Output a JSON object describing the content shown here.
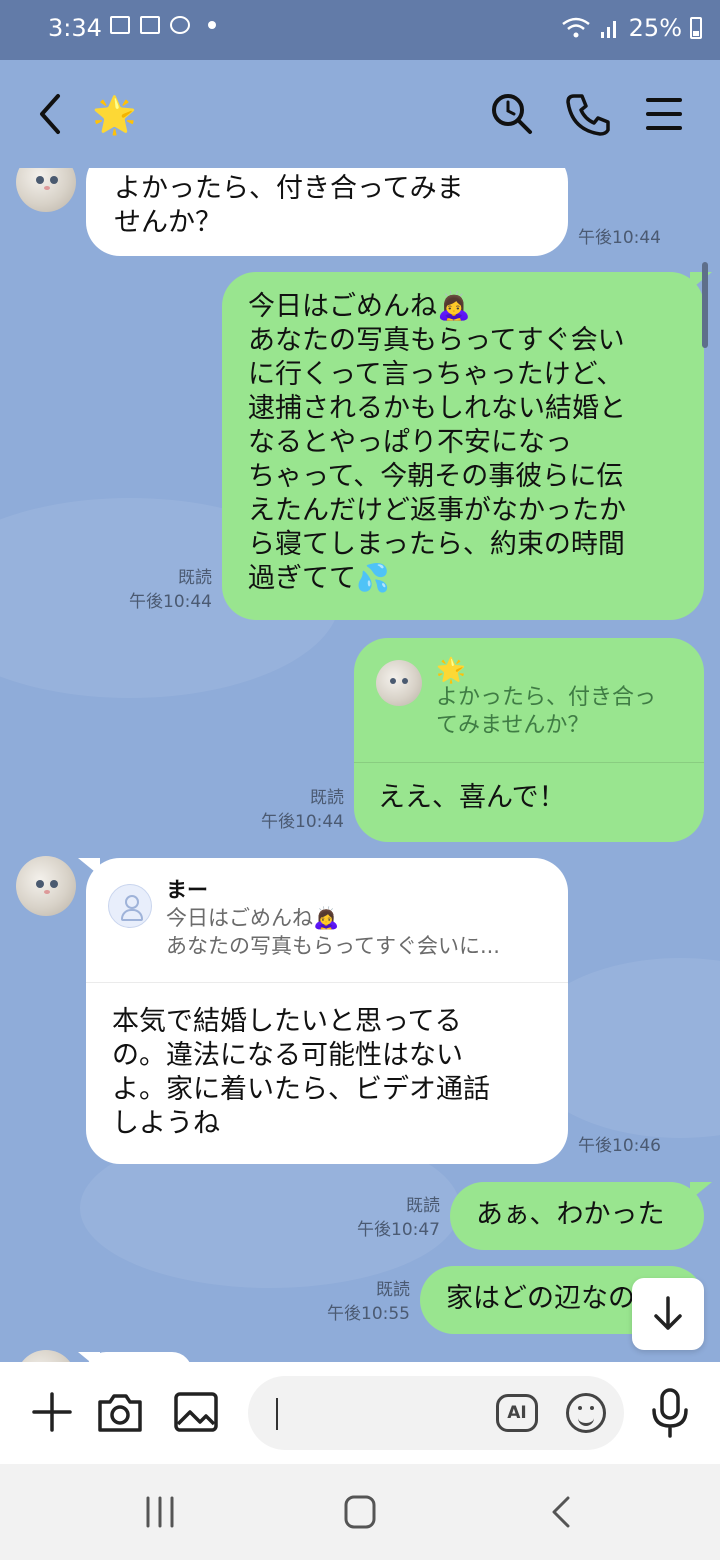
{
  "status_bar": {
    "time": "3:34",
    "battery": "25%"
  },
  "header": {
    "chat_title": "🌟"
  },
  "messages": [
    {
      "side": "left",
      "text": "よかったら、付き合ってみま\nせんか？",
      "time": "午後10:44"
    },
    {
      "side": "right",
      "text": "今日はごめんね🙇‍♀️\nあなたの写真もらってすぐ会い\nに行くって言っちゃったけど、\n逮捕されるかもしれない結婚と\nなるとやっぱり不安になっ\nちゃって、今朝その事彼らに伝\nえたんだけど返事がなかったか\nら寝てしまったら、約束の時間\n過ぎてて💦",
      "read": "既読",
      "time": "午後10:44"
    },
    {
      "side": "right",
      "quote_name": "🌟",
      "quote_text": "よかったら、付き合っ\nてみませんか？",
      "text": "ええ、喜んで！",
      "read": "既読",
      "time": "午後10:44"
    },
    {
      "side": "left",
      "quote_name": "まー",
      "quote_text": "今日はごめんね🙇‍♀️\nあなたの写真もらってすぐ会いに...",
      "text": "本気で結婚したいと思ってる\nの。違法になる可能性はない\nよ。家に着いたら、ビデオ通話\nしようね",
      "time": "午後10:46"
    },
    {
      "side": "right",
      "text": "あぁ、わかった",
      "read": "既読",
      "time": "午後10:47"
    },
    {
      "side": "right",
      "text": "家はどの辺なの",
      "read": "既読",
      "time": "午後10:55"
    }
  ],
  "input": {
    "placeholder": "",
    "ai_label": "AI"
  },
  "colors": {
    "background": "#8facd9",
    "bubble_green": "#99e58f",
    "bubble_white": "#ffffff"
  },
  "icons": [
    "back-icon",
    "search-icon",
    "phone-icon",
    "menu-icon",
    "plus-icon",
    "camera-icon",
    "image-icon",
    "ai-icon",
    "emoji-icon",
    "mic-icon",
    "scroll-down-icon"
  ]
}
